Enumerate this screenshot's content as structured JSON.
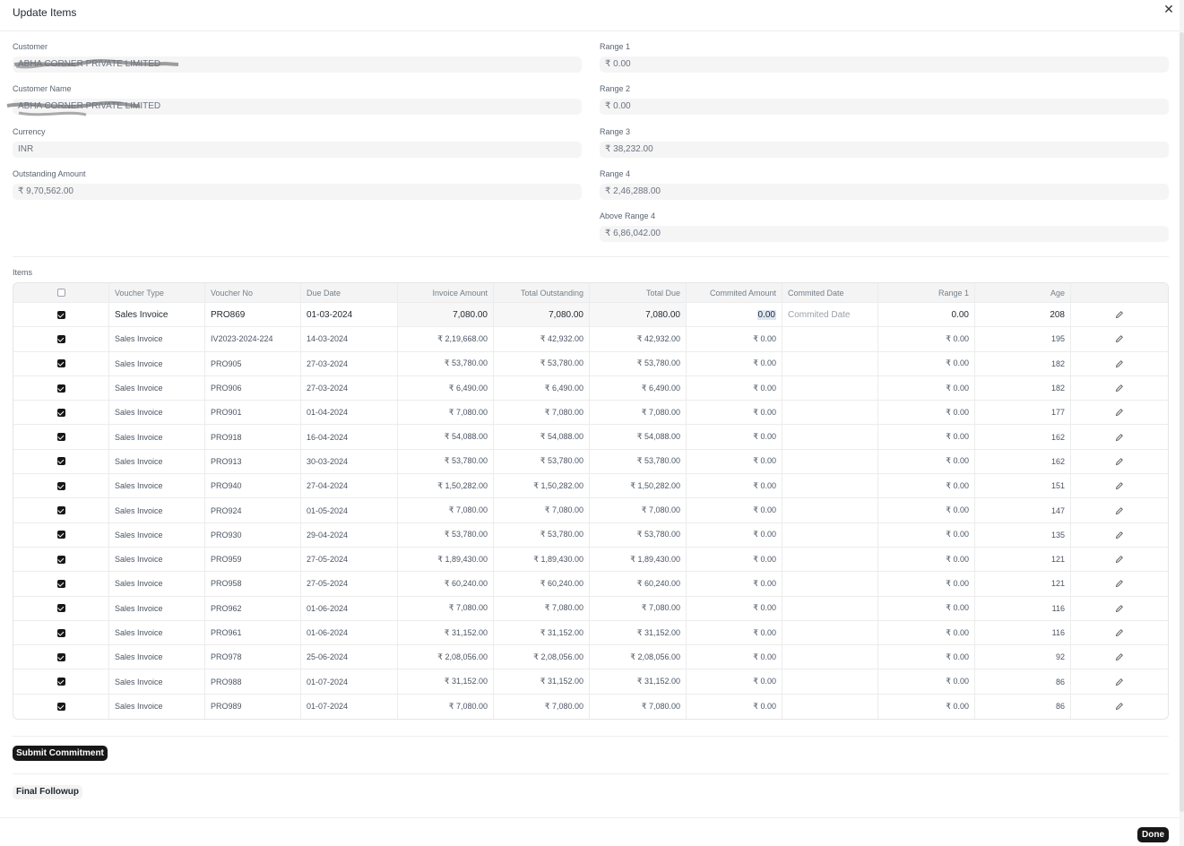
{
  "modal": {
    "title": "Update Items",
    "close_glyph": "✕"
  },
  "fields": {
    "customer": {
      "label": "Customer",
      "value": "ABHA CORNER PRIVATE LIMITED"
    },
    "customer_name": {
      "label": "Customer Name",
      "value": "ABHA CORNER PRIVATE LIMITED"
    },
    "currency": {
      "label": "Currency",
      "value": "INR"
    },
    "outstanding": {
      "label": "Outstanding Amount",
      "value": "₹ 9,70,562.00"
    },
    "range1": {
      "label": "Range 1",
      "value": "₹ 0.00"
    },
    "range2": {
      "label": "Range 2",
      "value": "₹ 0.00"
    },
    "range3": {
      "label": "Range 3",
      "value": "₹ 38,232.00"
    },
    "range4": {
      "label": "Range 4",
      "value": "₹ 2,46,288.00"
    },
    "above_range4": {
      "label": "Above Range 4",
      "value": "₹ 6,86,042.00"
    }
  },
  "items": {
    "label": "Items",
    "columns": [
      "Voucher Type",
      "Voucher No",
      "Due Date",
      "Invoice Amount",
      "Total Outstanding",
      "Total Due",
      "Commited Amount",
      "Commited Date",
      "Range 1",
      "Age"
    ],
    "first_row": {
      "type": "Sales Invoice",
      "no": "PRO869",
      "due": "01-03-2024",
      "inv": "7,080.00",
      "tout": "7,080.00",
      "tdue": "7,080.00",
      "camt": "0.00",
      "cdate_placeholder": "Commited Date",
      "r1": "0.00",
      "age": "208"
    },
    "rows": [
      {
        "type": "Sales Invoice",
        "no": "IV2023-2024-224",
        "due": "14-03-2024",
        "inv": "₹ 2,19,668.00",
        "tout": "₹ 42,932.00",
        "tdue": "₹ 42,932.00",
        "camt": "₹ 0.00",
        "r1": "₹ 0.00",
        "age": "195"
      },
      {
        "type": "Sales Invoice",
        "no": "PRO905",
        "due": "27-03-2024",
        "inv": "₹ 53,780.00",
        "tout": "₹ 53,780.00",
        "tdue": "₹ 53,780.00",
        "camt": "₹ 0.00",
        "r1": "₹ 0.00",
        "age": "182"
      },
      {
        "type": "Sales Invoice",
        "no": "PRO906",
        "due": "27-03-2024",
        "inv": "₹ 6,490.00",
        "tout": "₹ 6,490.00",
        "tdue": "₹ 6,490.00",
        "camt": "₹ 0.00",
        "r1": "₹ 0.00",
        "age": "182"
      },
      {
        "type": "Sales Invoice",
        "no": "PRO901",
        "due": "01-04-2024",
        "inv": "₹ 7,080.00",
        "tout": "₹ 7,080.00",
        "tdue": "₹ 7,080.00",
        "camt": "₹ 0.00",
        "r1": "₹ 0.00",
        "age": "177"
      },
      {
        "type": "Sales Invoice",
        "no": "PRO918",
        "due": "16-04-2024",
        "inv": "₹ 54,088.00",
        "tout": "₹ 54,088.00",
        "tdue": "₹ 54,088.00",
        "camt": "₹ 0.00",
        "r1": "₹ 0.00",
        "age": "162"
      },
      {
        "type": "Sales Invoice",
        "no": "PRO913",
        "due": "30-03-2024",
        "inv": "₹ 53,780.00",
        "tout": "₹ 53,780.00",
        "tdue": "₹ 53,780.00",
        "camt": "₹ 0.00",
        "r1": "₹ 0.00",
        "age": "162"
      },
      {
        "type": "Sales Invoice",
        "no": "PRO940",
        "due": "27-04-2024",
        "inv": "₹ 1,50,282.00",
        "tout": "₹ 1,50,282.00",
        "tdue": "₹ 1,50,282.00",
        "camt": "₹ 0.00",
        "r1": "₹ 0.00",
        "age": "151"
      },
      {
        "type": "Sales Invoice",
        "no": "PRO924",
        "due": "01-05-2024",
        "inv": "₹ 7,080.00",
        "tout": "₹ 7,080.00",
        "tdue": "₹ 7,080.00",
        "camt": "₹ 0.00",
        "r1": "₹ 0.00",
        "age": "147"
      },
      {
        "type": "Sales Invoice",
        "no": "PRO930",
        "due": "29-04-2024",
        "inv": "₹ 53,780.00",
        "tout": "₹ 53,780.00",
        "tdue": "₹ 53,780.00",
        "camt": "₹ 0.00",
        "r1": "₹ 0.00",
        "age": "135"
      },
      {
        "type": "Sales Invoice",
        "no": "PRO959",
        "due": "27-05-2024",
        "inv": "₹ 1,89,430.00",
        "tout": "₹ 1,89,430.00",
        "tdue": "₹ 1,89,430.00",
        "camt": "₹ 0.00",
        "r1": "₹ 0.00",
        "age": "121"
      },
      {
        "type": "Sales Invoice",
        "no": "PRO958",
        "due": "27-05-2024",
        "inv": "₹ 60,240.00",
        "tout": "₹ 60,240.00",
        "tdue": "₹ 60,240.00",
        "camt": "₹ 0.00",
        "r1": "₹ 0.00",
        "age": "121"
      },
      {
        "type": "Sales Invoice",
        "no": "PRO962",
        "due": "01-06-2024",
        "inv": "₹ 7,080.00",
        "tout": "₹ 7,080.00",
        "tdue": "₹ 7,080.00",
        "camt": "₹ 0.00",
        "r1": "₹ 0.00",
        "age": "116"
      },
      {
        "type": "Sales Invoice",
        "no": "PRO961",
        "due": "01-06-2024",
        "inv": "₹ 31,152.00",
        "tout": "₹ 31,152.00",
        "tdue": "₹ 31,152.00",
        "camt": "₹ 0.00",
        "r1": "₹ 0.00",
        "age": "116"
      },
      {
        "type": "Sales Invoice",
        "no": "PRO978",
        "due": "25-06-2024",
        "inv": "₹ 2,08,056.00",
        "tout": "₹ 2,08,056.00",
        "tdue": "₹ 2,08,056.00",
        "camt": "₹ 0.00",
        "r1": "₹ 0.00",
        "age": "92"
      },
      {
        "type": "Sales Invoice",
        "no": "PRO988",
        "due": "01-07-2024",
        "inv": "₹ 31,152.00",
        "tout": "₹ 31,152.00",
        "tdue": "₹ 31,152.00",
        "camt": "₹ 0.00",
        "r1": "₹ 0.00",
        "age": "86"
      },
      {
        "type": "Sales Invoice",
        "no": "PRO989",
        "due": "01-07-2024",
        "inv": "₹ 7,080.00",
        "tout": "₹ 7,080.00",
        "tdue": "₹ 7,080.00",
        "camt": "₹ 0.00",
        "r1": "₹ 0.00",
        "age": "86"
      }
    ]
  },
  "buttons": {
    "submit_commitment": "Submit Commitment",
    "final_followup": "Final Followup",
    "done": "Done"
  },
  "icons": {
    "close": "close-icon",
    "edit": "edit-icon",
    "checkbox": "checkbox-icon"
  }
}
